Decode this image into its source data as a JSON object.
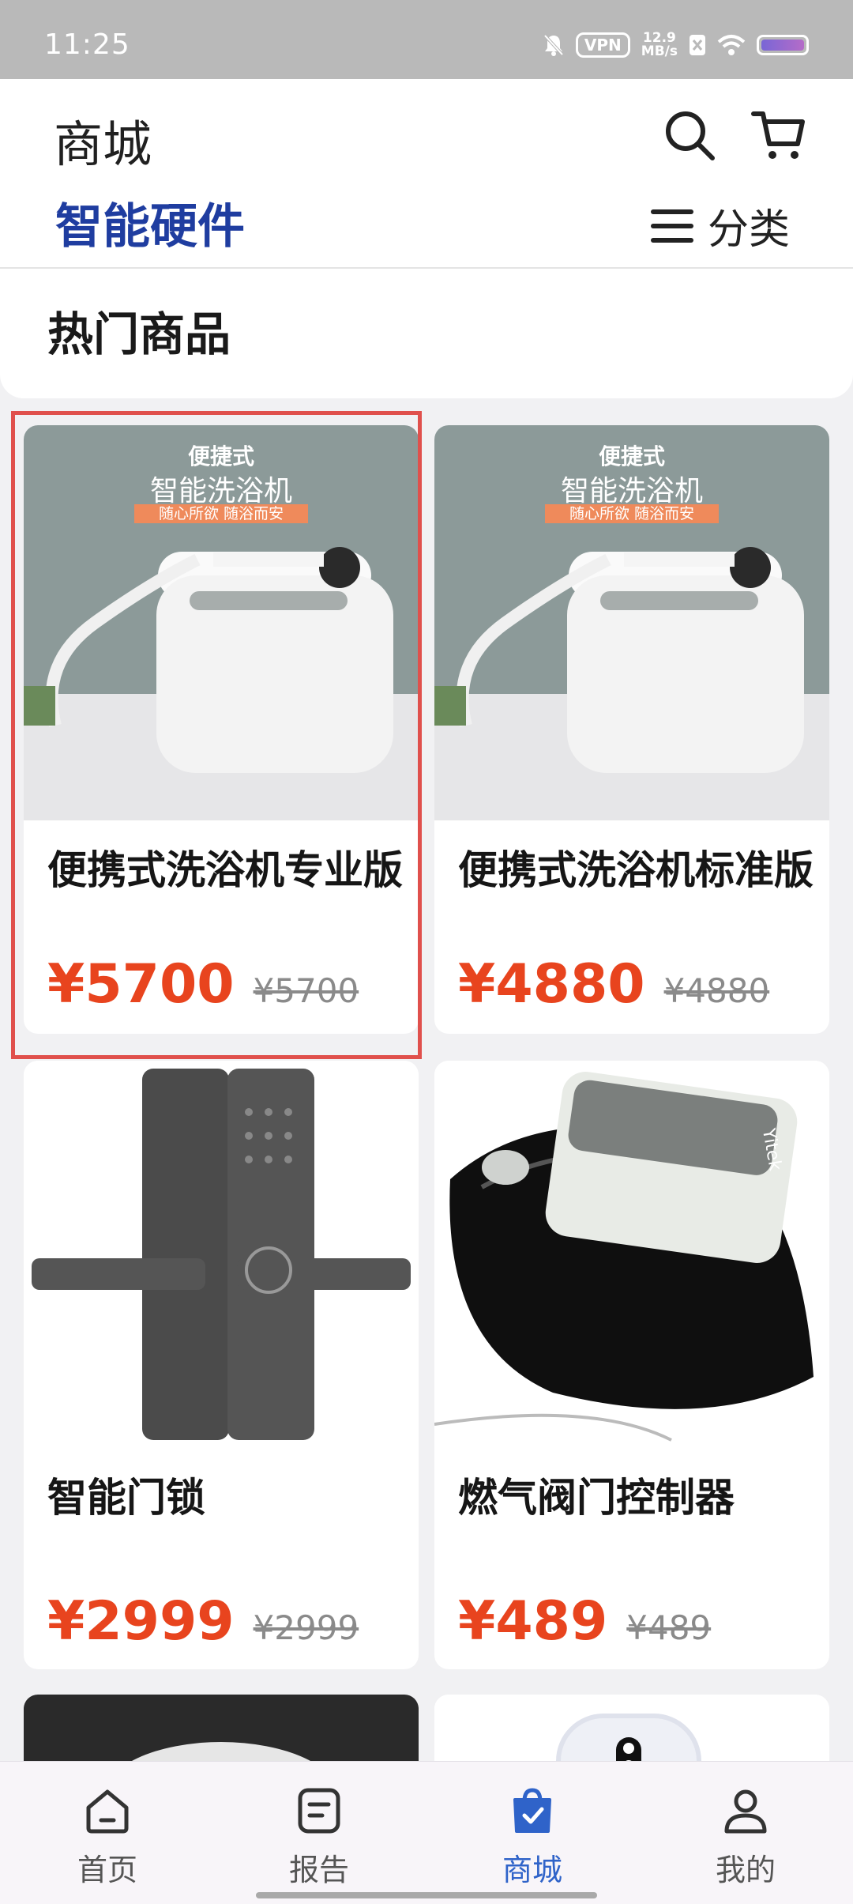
{
  "status_bar": {
    "time": "11:25",
    "vpn": "VPN",
    "speed_value": "12.9",
    "speed_unit": "MB/s"
  },
  "header": {
    "title": "商城",
    "category": "智能硬件",
    "classify_label": "分类"
  },
  "section": {
    "title": "热门商品"
  },
  "products": [
    {
      "name": "便携式洗浴机专业版",
      "price": "¥5700",
      "old_price": "¥5700",
      "banner": {
        "line1": "便捷式",
        "line2": "智能洗浴机",
        "tag": "随心所欲 随浴而安"
      }
    },
    {
      "name": "便携式洗浴机标准版",
      "price": "¥4880",
      "old_price": "¥4880",
      "banner": {
        "line1": "便捷式",
        "line2": "智能洗浴机",
        "tag": "随心所欲 随浴而安"
      }
    },
    {
      "name": "智能门锁",
      "price": "¥2999",
      "old_price": "¥2999"
    },
    {
      "name": "燃气阀门控制器",
      "price": "¥489",
      "old_price": "¥489",
      "device_brand": "Yitek"
    }
  ],
  "nav": [
    {
      "label": "首页",
      "icon": "home-icon"
    },
    {
      "label": "报告",
      "icon": "report-icon"
    },
    {
      "label": "商城",
      "icon": "shop-bag-icon",
      "active": true
    },
    {
      "label": "我的",
      "icon": "profile-icon"
    }
  ],
  "colors": {
    "brand_blue": "#1f3da0",
    "price_red": "#e8441e",
    "nav_active": "#2f63c9",
    "highlight_border": "#e0504c"
  }
}
